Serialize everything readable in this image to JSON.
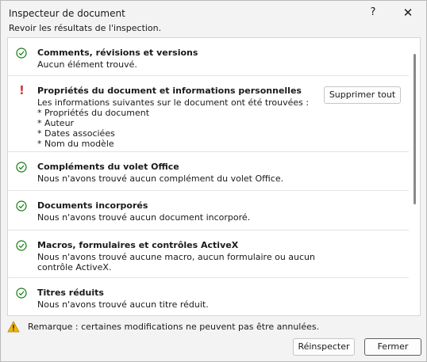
{
  "window": {
    "title": "Inspecteur de document",
    "help_glyph": "?",
    "close_glyph": "✕",
    "subtitle": "Revoir les résultats de l'inspection."
  },
  "results": [
    {
      "status": "ok",
      "heading": "Comments, révisions et versions",
      "detail": "Aucun élément trouvé."
    },
    {
      "status": "warning",
      "heading": "Propriétés du document et informations personnelles",
      "detail": "Les informations suivantes sur le document ont été trouvées :\n* Propriétés du document\n* Auteur\n* Dates associées\n* Nom du modèle",
      "action_label": "Supprimer tout"
    },
    {
      "status": "ok",
      "heading": "Compléments du volet Office",
      "detail": "Nous n'avons trouvé aucun complément du volet Office."
    },
    {
      "status": "ok",
      "heading": "Documents incorporés",
      "detail": "Nous n'avons trouvé aucun document incorporé."
    },
    {
      "status": "ok",
      "heading": "Macros, formulaires et contrôles ActiveX",
      "detail": "Nous n'avons trouvé aucune macro, aucun formulaire ou aucun\ncontrôle ActiveX."
    },
    {
      "status": "ok",
      "heading": "Titres réduits",
      "detail": "Nous n'avons trouvé aucun titre réduit."
    }
  ],
  "footer": {
    "note": "Remarque : certaines modifications ne peuvent pas être annulées.",
    "reinspect_label": "Réinspecter",
    "close_label": "Fermer"
  },
  "colors": {
    "ok": "#107c10",
    "warning": "#d13438",
    "caution": "#f2b705"
  }
}
